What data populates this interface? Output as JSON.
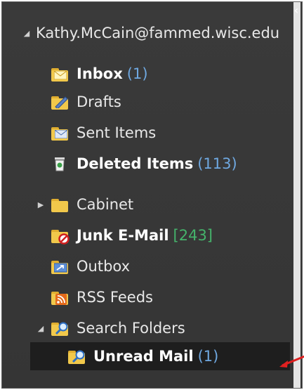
{
  "account": {
    "label": "Kathy.McCain@fammed.wisc.edu",
    "expand_glyph": "◢"
  },
  "collapse_glyph": "‹",
  "folders": [
    {
      "label": "Inbox",
      "count": "(1)",
      "bold": true,
      "icon": "inbox-icon"
    },
    {
      "label": "Drafts",
      "count": "",
      "bold": false,
      "icon": "drafts-icon"
    },
    {
      "label": "Sent Items",
      "count": "",
      "bold": false,
      "icon": "sent-items-icon"
    },
    {
      "label": "Deleted Items",
      "count": "(113)",
      "bold": true,
      "icon": "deleted-items-icon"
    },
    {
      "label": "Cabinet",
      "count": "",
      "bold": false,
      "icon": "cabinet-folder-icon",
      "expand_glyph": "▶"
    },
    {
      "label": "Junk E-Mail",
      "count": "[243]",
      "bold": true,
      "icon": "junk-email-icon"
    },
    {
      "label": "Outbox",
      "count": "",
      "bold": false,
      "icon": "outbox-icon"
    },
    {
      "label": "RSS Feeds",
      "count": "",
      "bold": false,
      "icon": "rss-feeds-icon"
    },
    {
      "label": "Search Folders",
      "count": "",
      "bold": false,
      "icon": "search-folders-icon",
      "expand_glyph": "◢"
    },
    {
      "label": "Unread Mail",
      "count": "(1)",
      "bold": true,
      "icon": "unread-mail-icon",
      "selected": true
    }
  ],
  "colors": {
    "pane_bg": "#3a3a3a",
    "selected_bg": "#1e1e1e",
    "count_blue": "#6fa8e0",
    "count_green": "#45b36b",
    "folder_yellow": "#f1c84b",
    "annotation_red": "#e02020"
  }
}
